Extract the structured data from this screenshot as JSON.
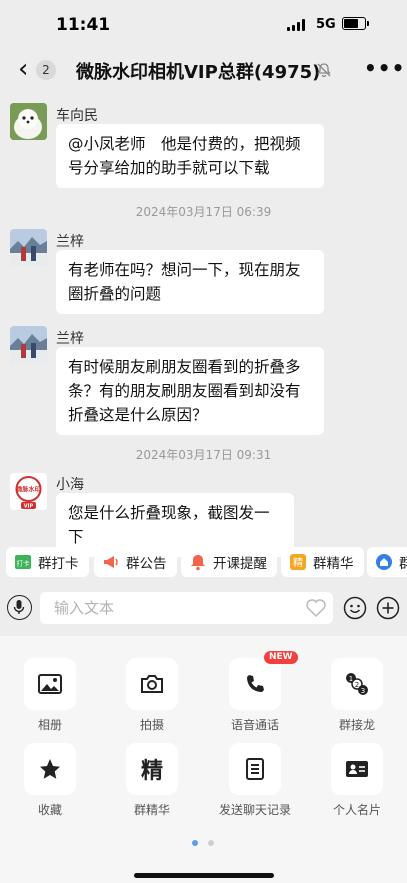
{
  "status": {
    "time": "11:41",
    "network": "5G"
  },
  "nav": {
    "back_count": "2",
    "title": "微脉水印相机VIP总群(4975)"
  },
  "messages": [
    {
      "sender": "车向民",
      "text": "@小凤老师　他是付费的，把视频号分享给加的助手就可以下载"
    },
    {
      "timestamp": "2024年03月17日 06:39"
    },
    {
      "sender": "兰梓",
      "text": "有老师在吗？想问一下，现在朋友圈折叠的问题"
    },
    {
      "sender": "兰梓",
      "text": "有时候朋友刷朋友圈看到的折叠多条？有的朋友刷朋友圈看到却没有折叠这是什么原因？"
    },
    {
      "timestamp": "2024年03月17日 09:31"
    },
    {
      "sender": "小海",
      "text": "您是什么折叠现象，截图发一下",
      "avatar_text": "微脉水印",
      "avatar_badge": "VIP"
    }
  ],
  "shortcuts": [
    {
      "label": "群打卡",
      "icon": "checkin-icon",
      "icon_text": "打卡",
      "color": "#3db35a"
    },
    {
      "label": "群公告",
      "icon": "megaphone-icon",
      "color": "#f2654a"
    },
    {
      "label": "开课提醒",
      "icon": "bell-icon",
      "color": "#f2654a"
    },
    {
      "label": "群精华",
      "icon": "essence-icon",
      "icon_text": "精",
      "color": "#f5a623"
    },
    {
      "label": "群",
      "icon": "home-icon",
      "color": "#2f80ed"
    }
  ],
  "input": {
    "placeholder": "输入文本"
  },
  "panel": {
    "items": [
      {
        "label": "相册",
        "icon": "image-icon"
      },
      {
        "label": "拍摄",
        "icon": "camera-icon"
      },
      {
        "label": "语音通话",
        "icon": "phone-icon"
      },
      {
        "label": "群接龙",
        "icon": "relay-icon"
      },
      {
        "label": "收藏",
        "icon": "star-icon"
      },
      {
        "label": "群精华",
        "icon": "essence-icon",
        "icon_text": "精"
      },
      {
        "label": "发送聊天记录",
        "icon": "chat-record-icon"
      },
      {
        "label": "个人名片",
        "icon": "contact-card-icon"
      }
    ],
    "new_badge": "NEW",
    "relay_digits": [
      "1",
      "2",
      "3"
    ],
    "page_count": 2,
    "active_page": 1
  }
}
